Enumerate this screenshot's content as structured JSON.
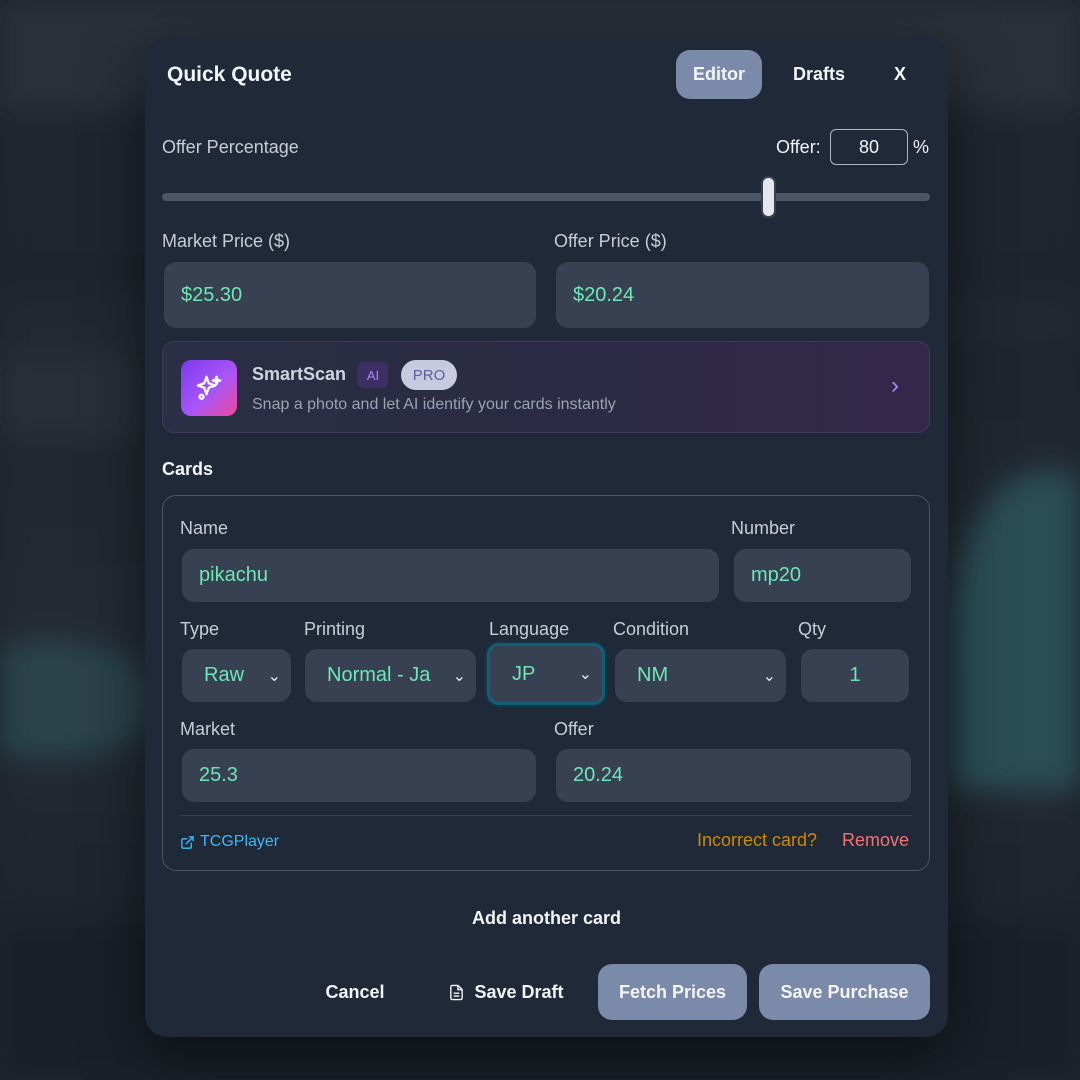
{
  "modal": {
    "title": "Quick Quote",
    "tabs": [
      {
        "label": "Editor",
        "active": true
      },
      {
        "label": "Drafts",
        "active": false
      }
    ],
    "close_label": "X"
  },
  "offer": {
    "label": "Offer Percentage",
    "input_label": "Offer:",
    "value": "80",
    "unit": "%",
    "slider_percent": 80
  },
  "prices": {
    "market_label": "Market Price ($)",
    "market_value": "$25.30",
    "offer_label": "Offer Price ($)",
    "offer_value": "$20.24"
  },
  "smartscan": {
    "title": "SmartScan",
    "ai_badge": "AI",
    "pro_badge": "PRO",
    "subtitle": "Snap a photo and let AI identify your cards instantly",
    "icon": "sparkles-icon"
  },
  "cards": {
    "section_title": "Cards",
    "items": [
      {
        "name_label": "Name",
        "name": "pikachu",
        "number_label": "Number",
        "number": "mp20",
        "type_label": "Type",
        "type": "Raw",
        "printing_label": "Printing",
        "printing": "Normal - Ja",
        "language_label": "Language",
        "language": "JP",
        "condition_label": "Condition",
        "condition": "NM",
        "qty_label": "Qty",
        "qty": "1",
        "market_label": "Market",
        "market": "25.3",
        "offer_label": "Offer",
        "offer": "20.24",
        "link_label": "TCGPlayer",
        "incorrect_label": "Incorrect card?",
        "remove_label": "Remove"
      }
    ],
    "add_label": "Add another card"
  },
  "actions": {
    "cancel": "Cancel",
    "save_draft": "Save Draft",
    "fetch_prices": "Fetch Prices",
    "save_purchase": "Save Purchase"
  },
  "colors": {
    "accent_value": "#6ee7b7",
    "primary_button": "#7a8aa8",
    "warning": "#ca8a04",
    "danger": "#f87171",
    "link": "#38bdf8"
  }
}
